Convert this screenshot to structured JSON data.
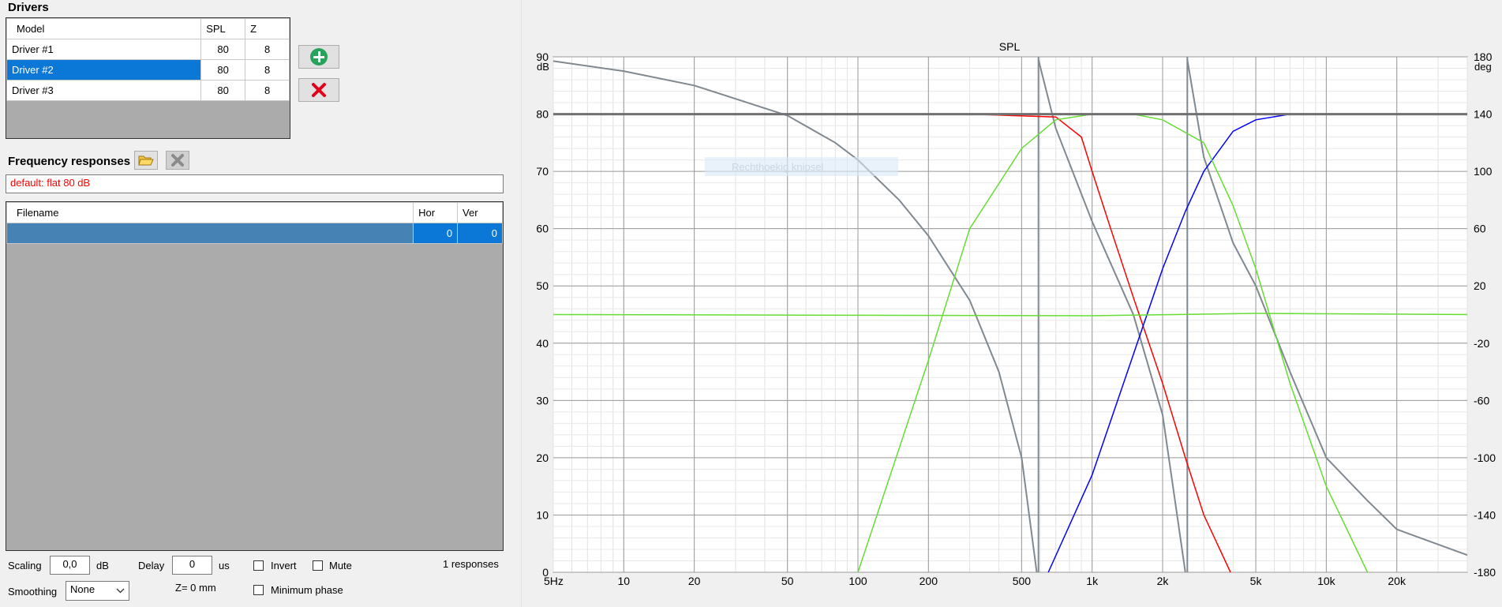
{
  "drivers": {
    "title": "Drivers",
    "columns": [
      "Model",
      "SPL",
      "Z"
    ],
    "rows": [
      {
        "model": "Driver #1",
        "spl": "80",
        "z": "8",
        "selected": false
      },
      {
        "model": "Driver #2",
        "spl": "80",
        "z": "8",
        "selected": true
      },
      {
        "model": "Driver #3",
        "spl": "80",
        "z": "8",
        "selected": false
      }
    ],
    "add_icon": "plus-circle-icon",
    "remove_icon": "red-x-icon"
  },
  "frequency_responses": {
    "title": "Frequency responses",
    "open_icon": "folder-open-icon",
    "delete_icon": "gray-x-icon",
    "default_text": "default: flat 80 dB",
    "columns": [
      "Filename",
      "Hor",
      "Ver"
    ],
    "row": {
      "filename": "",
      "hor": "0",
      "ver": "0"
    },
    "colors": {
      "default_text": "#ff0000",
      "selection": "#4682b4"
    }
  },
  "controls": {
    "scaling_label": "Scaling",
    "scaling_value": "0,0",
    "scaling_unit": "dB",
    "delay_label": "Delay",
    "delay_value": "0",
    "delay_unit": "us",
    "invert_label": "Invert",
    "mute_label": "Mute",
    "responses_count": "1 responses",
    "smoothing_label": "Smoothing",
    "smoothing_value": "None",
    "z_label": "Z= 0 mm",
    "minimum_phase_label": "Minimum phase"
  },
  "overlay_text": "Rechthoekig knipsel",
  "chart_data": {
    "type": "line",
    "title": "SPL",
    "left_axis_unit": "dB",
    "right_axis_unit": "deg",
    "x_scale": "log",
    "xlim": [
      5,
      40000
    ],
    "x_ticks": [
      5,
      10,
      20,
      50,
      100,
      200,
      500,
      1000,
      2000,
      5000,
      10000,
      20000
    ],
    "x_tick_labels": [
      "5Hz",
      "10",
      "20",
      "50",
      "100",
      "200",
      "500",
      "1k",
      "2k",
      "5k",
      "10k",
      "20k"
    ],
    "ylim": [
      0,
      90
    ],
    "y_ticks": [
      0,
      10,
      20,
      30,
      40,
      50,
      60,
      70,
      80,
      90
    ],
    "y2lim": [
      -180,
      180
    ],
    "y2_ticks": [
      -180,
      -140,
      -100,
      -60,
      -20,
      20,
      60,
      100,
      140,
      180
    ],
    "grid": true,
    "series": [
      {
        "color": "#808890",
        "axis": "y2",
        "points": [
          [
            5,
            177
          ],
          [
            10,
            170
          ],
          [
            20,
            160
          ],
          [
            50,
            139
          ],
          [
            80,
            120
          ],
          [
            100,
            108
          ],
          [
            150,
            80
          ],
          [
            200,
            55
          ],
          [
            300,
            10
          ],
          [
            400,
            -40
          ],
          [
            500,
            -100
          ],
          [
            580,
            -180
          ],
          [
            590,
            178
          ],
          [
            700,
            130
          ],
          [
            1000,
            65
          ],
          [
            1500,
            0
          ],
          [
            2000,
            -70
          ],
          [
            2500,
            -180
          ],
          [
            2550,
            178
          ],
          [
            3000,
            110
          ],
          [
            4000,
            50
          ],
          [
            5000,
            20
          ],
          [
            7000,
            -40
          ],
          [
            10000,
            -100
          ],
          [
            15000,
            -130
          ],
          [
            20000,
            -150
          ],
          [
            40000,
            -168
          ]
        ]
      },
      {
        "color": "#ff0000",
        "points": [
          [
            5,
            80
          ],
          [
            300,
            80
          ],
          [
            700,
            79.5
          ],
          [
            900,
            76
          ],
          [
            1000,
            70
          ],
          [
            1200,
            60
          ],
          [
            1500,
            48
          ],
          [
            2000,
            33
          ],
          [
            2500,
            20
          ],
          [
            3000,
            10
          ],
          [
            3900,
            0
          ]
        ]
      },
      {
        "color": "#0000ff",
        "points": [
          [
            650,
            0
          ],
          [
            1000,
            17
          ],
          [
            1500,
            38
          ],
          [
            2000,
            53
          ],
          [
            2500,
            63
          ],
          [
            3000,
            70
          ],
          [
            4000,
            77
          ],
          [
            5000,
            79
          ],
          [
            7000,
            80
          ],
          [
            40000,
            80
          ]
        ]
      },
      {
        "color": "#66dd33",
        "points": [
          [
            100,
            0
          ],
          [
            200,
            37
          ],
          [
            300,
            60
          ],
          [
            500,
            74
          ],
          [
            700,
            79
          ],
          [
            1000,
            80
          ],
          [
            1500,
            80
          ],
          [
            2000,
            79
          ],
          [
            3000,
            75
          ],
          [
            4000,
            64
          ],
          [
            5000,
            53
          ],
          [
            7000,
            33
          ],
          [
            10000,
            15
          ],
          [
            15000,
            0
          ]
        ]
      },
      {
        "color": "#66dd33",
        "points": [
          [
            5,
            45
          ],
          [
            1000,
            44.8
          ],
          [
            5000,
            45.2
          ],
          [
            40000,
            45
          ]
        ]
      },
      {
        "color": "#707070",
        "points": [
          [
            5,
            80
          ],
          [
            40000,
            80
          ]
        ]
      }
    ]
  }
}
